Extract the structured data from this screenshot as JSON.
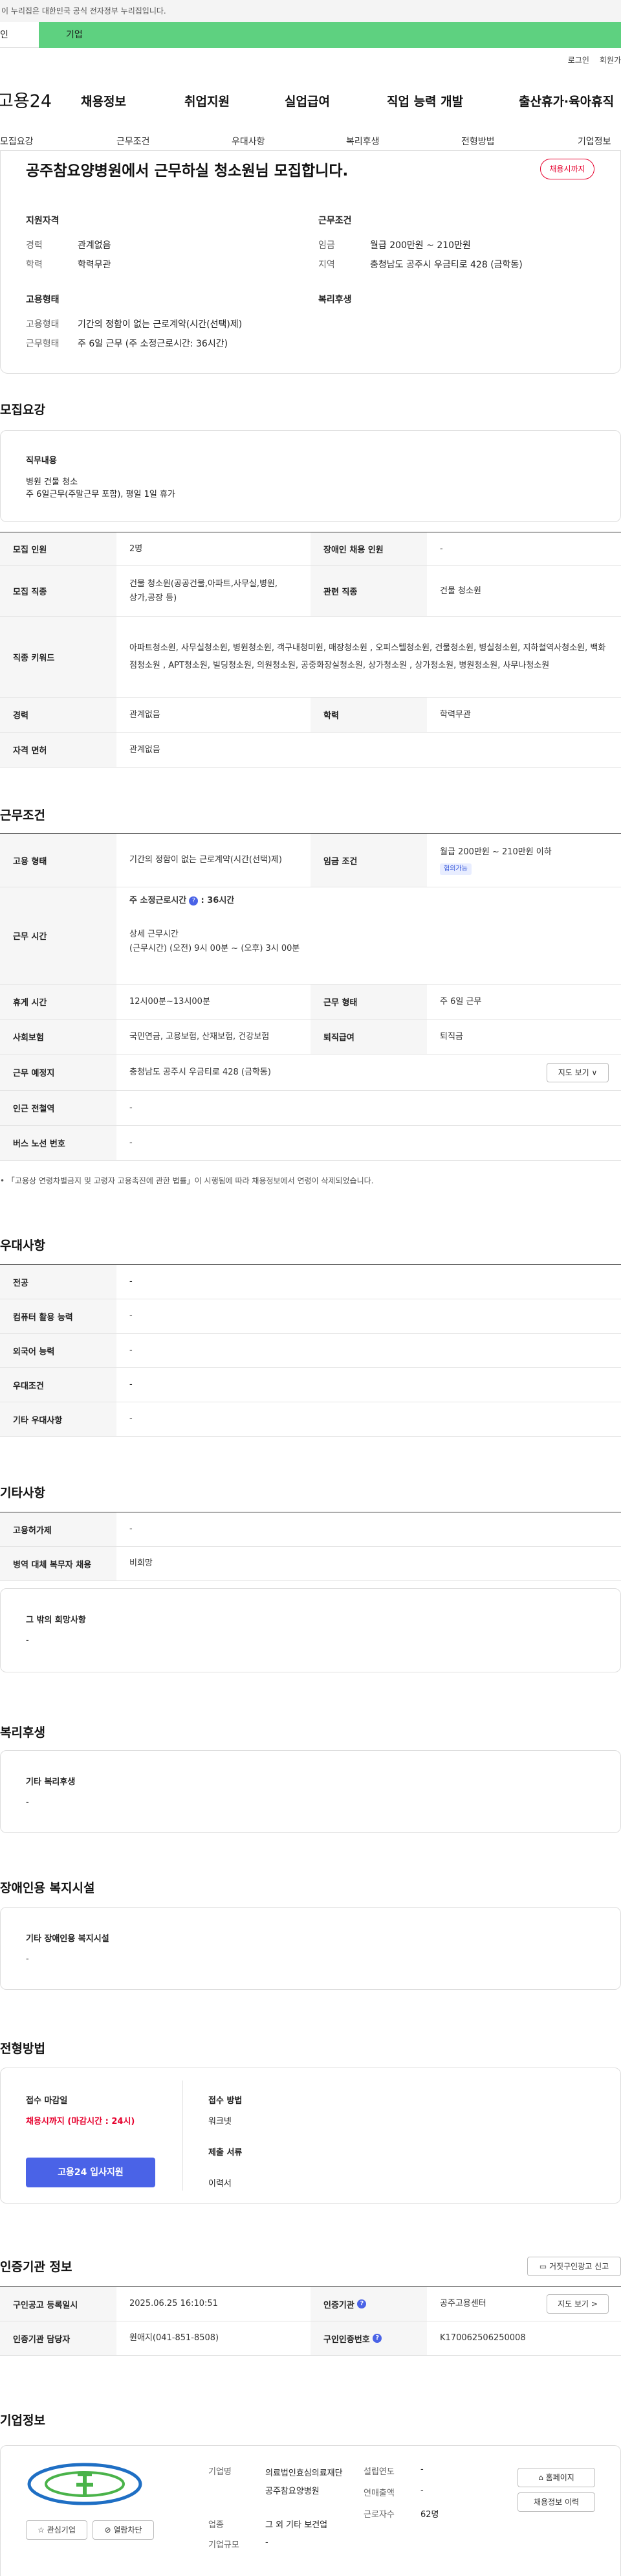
{
  "gov_banner": "이 누리집은 대한민국 공식 전자정부 누리집입니다.",
  "top_tabs": {
    "individual": "인",
    "corporate": "기업"
  },
  "util": {
    "login": "로그인",
    "signup": "회원가"
  },
  "logo": "고용24",
  "gnb": [
    "채용정보",
    "취업지원",
    "실업급여",
    "직업 능력 개발",
    "출산휴가·육아휴직"
  ],
  "subnav": [
    "모집요강",
    "근무조건",
    "우대사항",
    "복리후생",
    "전형방법",
    "기업정보"
  ],
  "header": {
    "title": "공주참요양병원에서 근무하실 청소원님 모집합니다.",
    "badge": "채용시까지",
    "qual_title": "지원자격",
    "qual": [
      {
        "label": "경력",
        "value": "관계없음"
      },
      {
        "label": "학력",
        "value": "학력무관"
      }
    ],
    "cond_title": "근무조건",
    "cond": [
      {
        "label": "임금",
        "value": "월급 200만원 ~ 210만원"
      },
      {
        "label": "지역",
        "value": "충청남도 공주시 우금티로 428 (금학동)"
      }
    ],
    "emp_title": "고용형태",
    "emp": [
      {
        "label": "고용형태",
        "value": "기간의 정함이 없는 근로계약(시간(선택)제)"
      },
      {
        "label": "근무형태",
        "value": "주 6일 근무 (주 소정근로시간: 36시간)"
      }
    ],
    "welfare_title": "복리후생"
  },
  "recruit": {
    "heading": "모집요강",
    "duty_title": "직무내용",
    "duty_lines": [
      "병원 건물 청소",
      "주 6일근무(주말근무 포함), 평일 1일 휴가"
    ],
    "rows": [
      {
        "h1": "모집 인원",
        "v1": "2명",
        "h2": "장애인 채용 인원",
        "v2": "-"
      },
      {
        "h1": "모집 직종",
        "v1": "건물 청소원(공공건물,아파트,사무실,병원,\n상가,공장 등)",
        "h2": "관련 직종",
        "v2": "건물 청소원"
      },
      {
        "h1": "직종 키워드",
        "v1": "아파트청소원, 사무실청소원, 병원청소원, 객구내청미원, 매장청소원 , 오피스텔청소원, 건물청소원, 병실청소원, 지하철역사청소원, 백화점청소원 , APT청소원, 빌딩청소원, 의원청소원, 공중화장실청소원, 상가청소원 , 상가청소원, 병원청소원, 사무나청소원"
      },
      {
        "h1": "경력",
        "v1": "관계없음",
        "h2": "학력",
        "v2": "학력무관"
      },
      {
        "h1": "자격 면허",
        "v1": "관계없음"
      }
    ]
  },
  "work": {
    "heading": "근무조건",
    "rows": [
      {
        "h1": "고용 형태",
        "v1": "기간의 정함이 없는 근로계약(시간(선택)제)",
        "h2": "임금 조건",
        "v2": "월급 200만원 ~ 210만원 이하",
        "v2_badge": "협의가능"
      },
      {
        "h1": "근무 시간",
        "hours_title": "주 소정근로시간",
        "hours_value": ": 36시간",
        "detail_title": "상세 근무시간",
        "detail_value": "(근무시간) (오전) 9시 00분 ~ (오후) 3시 00분"
      },
      {
        "h1": "휴게 시간",
        "v1": "12시00분~13시00분",
        "h2": "근무 형태",
        "v2": "주 6일 근무"
      },
      {
        "h1": "사회보험",
        "v1": "국민연금, 고용보험, 산재보험, 건강보험",
        "h2": "퇴직급여",
        "v2": "퇴직금"
      },
      {
        "h1": "근무 예정지",
        "v1": "충청남도 공주시 우금티로 428 (금학동)",
        "btn": "지도 보기 ∨"
      },
      {
        "h1": "인근 전철역",
        "v1": "-"
      },
      {
        "h1": "버스 노선 번호",
        "v1": "-"
      }
    ],
    "note": "「고용상 연령차별금지 및 고령자 고용촉진에 관한 법률」이 시행됨에 따라 채용정보에서 연령이 삭제되었습니다."
  },
  "pref": {
    "heading": "우대사항",
    "rows": [
      {
        "h": "전공",
        "v": "-"
      },
      {
        "h": "컴퓨터 활용 능력",
        "v": "-"
      },
      {
        "h": "외국어 능력",
        "v": "-"
      },
      {
        "h": "우대조건",
        "v": "-"
      },
      {
        "h": "기타 우대사항",
        "v": "-"
      }
    ]
  },
  "other": {
    "heading": "기타사항",
    "rows": [
      {
        "h": "고용허가제",
        "v": "-"
      },
      {
        "h": "병역 대체 복무자 채용",
        "v": "비희망"
      }
    ],
    "box_title": "그 밖의 희망사항",
    "box_value": "-"
  },
  "welfare": {
    "heading": "복리후생",
    "box_title": "기타 복리후생",
    "box_value": "-"
  },
  "disability": {
    "heading": "장애인용 복지시설",
    "box_title": "기타 장애인용 복지시설",
    "box_value": "-"
  },
  "selection": {
    "heading": "전형방법",
    "deadline_title": "접수 마감일",
    "deadline_value": "채용시까지 (마감시간 : 24시)",
    "apply_btn": "고용24 입사지원",
    "method_title": "접수 방법",
    "method_value": "워크넷",
    "docs_title": "제출 서류",
    "docs_value": "이력서"
  },
  "certification": {
    "heading": "인증기관 정보",
    "report_btn": "거짓구인광고 신고",
    "rows": [
      {
        "h1": "구인공고 등록일시",
        "v1": "2025.06.25 16:10:51",
        "h2": "인증기관",
        "v2": "공주고용센터",
        "btn": "지도 보기 >"
      },
      {
        "h1": "인증기관 담당자",
        "v1": "원애지(041-851-8508)",
        "h2": "구인인증번호",
        "v2": "K170062506250008"
      }
    ]
  },
  "company": {
    "heading": "기업정보",
    "fav_btn": "관심기업",
    "block_btn": "열람차단",
    "fields": [
      {
        "label": "기업명",
        "value": "의료법인효심의료재단공주참요양병원"
      },
      {
        "label": "업종",
        "value": "그 외 기타 보건업"
      },
      {
        "label": "기업규모",
        "value": "-"
      }
    ],
    "fields2": [
      {
        "label": "설립연도",
        "value": "-"
      },
      {
        "label": "연매출액",
        "value": "-"
      },
      {
        "label": "근로자수",
        "value": "62명"
      }
    ],
    "homepage_btn": "홈페이지",
    "history_btn": "채용정보 이력"
  }
}
